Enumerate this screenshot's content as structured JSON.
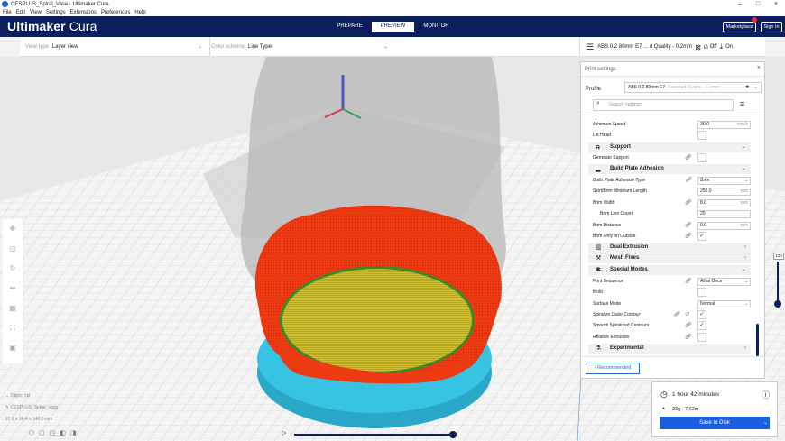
{
  "window": {
    "title": "CESPLUS_Spiral_Vase - Ultimaker Cura",
    "controls": [
      "–",
      "□",
      "×"
    ]
  },
  "menu": [
    "File",
    "Edit",
    "View",
    "Settings",
    "Extensions",
    "Preferences",
    "Help"
  ],
  "header": {
    "brand_bold": "Ultimaker",
    "brand_thin": " Cura",
    "tabs": [
      {
        "label": "PREPARE",
        "active": false
      },
      {
        "label": "PREVIEW",
        "active": true
      },
      {
        "label": "MONITOR",
        "active": false
      }
    ],
    "marketplace": "Marketplace",
    "signin": "Sign In"
  },
  "toolbar": {
    "view_type_label": "View type",
    "view_type_value": "Layer view",
    "color_scheme_label": "Color scheme",
    "color_scheme_value": "Line Type",
    "print_setup": "ABS 0.2 80mm E7 ... d Quality - 0.2mm",
    "support_state": "Off",
    "adhesion_state": "On"
  },
  "settings_panel": {
    "title": "Print settings",
    "close": "×",
    "profile_label": "Profile",
    "profile_value": "ABS 0.2 80mm E7",
    "profile_secondary": "Standard Quality - 0.2mm",
    "search_placeholder": "Search settings",
    "rows": [
      {
        "label": "Minimum Speed",
        "value": "30.0",
        "unit": "mm/s",
        "italic": true
      },
      {
        "label": "Lift Head",
        "checkbox": true
      },
      {
        "label": "Generate Support",
        "checkbox": true,
        "link": true
      },
      {
        "label": "Build Plate Adhesion Type",
        "value": "Brim",
        "dropdown": true,
        "italic": true,
        "link": true
      },
      {
        "label": "Skirt/Brim Minimum Length",
        "value": "250.0",
        "unit": "mm"
      },
      {
        "label": "Brim Width",
        "value": "8.0",
        "unit": "mm",
        "link": true
      },
      {
        "label": "Brim Line Count",
        "value": "20",
        "indent": true
      },
      {
        "label": "Brim Distance",
        "value": "0.0",
        "unit": "mm",
        "link": true
      },
      {
        "label": "Brim Only on Outside",
        "checkbox": true,
        "checked": true,
        "link": true
      },
      {
        "label": "Print Sequence",
        "value": "All at Once",
        "dropdown": true,
        "link": true
      },
      {
        "label": "Mold",
        "checkbox": true
      },
      {
        "label": "Surface Mode",
        "value": "Normal",
        "dropdown": true
      },
      {
        "label": "Spiralize Outer Contour",
        "checkbox": true,
        "checked": true,
        "italic": true,
        "link": true,
        "reset": true
      },
      {
        "label": "Smooth Spiralized Contours",
        "checkbox": true,
        "checked": true,
        "link": true
      },
      {
        "label": "Relative Extrusion",
        "checkbox": true,
        "link": true
      }
    ],
    "categories": [
      {
        "label": "Support",
        "expanded": true
      },
      {
        "label": "Build Plate Adhesion",
        "expanded": true
      },
      {
        "label": "Dual Extrusion",
        "expanded": false
      },
      {
        "label": "Mesh Fixes",
        "expanded": false
      },
      {
        "label": "Special Modes",
        "expanded": true
      },
      {
        "label": "Experimental",
        "expanded": false
      }
    ],
    "recommended_button": "Recommended"
  },
  "layer_slider": {
    "value": "120"
  },
  "job": {
    "name_label": "Object list",
    "file_name": "CESPLUS_Spiral_Vase",
    "dimensions": "97.1 x 96.4 x 140.0 mm"
  },
  "estimate": {
    "time": "1 hour 42 minutes",
    "material": "23g · 7.62m",
    "save_button": "Save to Disk"
  },
  "colors": {
    "header_bg": "#0a1f5c",
    "accent": "#1b5ee0",
    "vase_red": "#ee3a12",
    "infill_yellow": "#c8b82c",
    "brim_cyan": "#37c4e4"
  }
}
